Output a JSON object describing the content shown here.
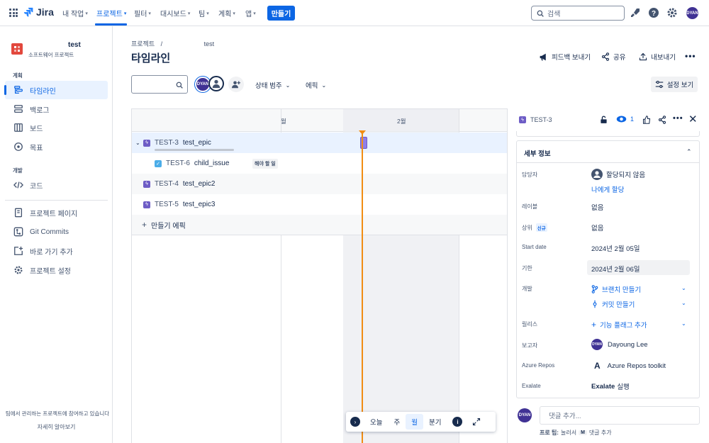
{
  "topnav": {
    "logo": "Jira",
    "items": [
      "내 작업",
      "프로젝트",
      "필터",
      "대시보드",
      "팀",
      "계획",
      "앱"
    ],
    "create": "만들기",
    "search_placeholder": "검색",
    "avatar": "DYAN"
  },
  "sidebar": {
    "project_name": "test",
    "project_type": "소프트웨어 프로젝트",
    "section_plan": "계획",
    "plan_items": [
      "타임라인",
      "백로그",
      "보드",
      "목표"
    ],
    "section_dev": "개발",
    "dev_items": [
      "코드"
    ],
    "other_items": [
      "프로젝트 페이지",
      "Git Commits",
      "바로 가기 추가",
      "프로젝트 설정"
    ],
    "footer_text": "팀에서 관리하는 프로젝트에 참여하고 있습니다",
    "footer_link": "자세히 알아보기"
  },
  "main": {
    "breadcrumb_root": "프로젝트",
    "breadcrumb_sep": "/",
    "breadcrumb_current": "test",
    "title": "타임라인",
    "actions": [
      "피드백 보내기",
      "공유",
      "내보내기"
    ],
    "filter_avatar": "DYAN",
    "filters": [
      "상태 범주",
      "에픽"
    ],
    "view_settings": "설정 보기"
  },
  "timeline": {
    "months": [
      "월",
      "2월"
    ],
    "rows": [
      {
        "key": "TEST-3",
        "summary": "test_epic",
        "type": "epic",
        "expanded": true
      },
      {
        "key": "TEST-6",
        "summary": "child_issue",
        "type": "task",
        "status": "해야 할 일"
      },
      {
        "key": "TEST-4",
        "summary": "test_epic2",
        "type": "epic"
      },
      {
        "key": "TEST-5",
        "summary": "test_epic3",
        "type": "epic"
      }
    ],
    "create_epic": "만들기 에픽",
    "bottom": [
      "오늘",
      "주",
      "월",
      "분기"
    ],
    "active_scale": "월"
  },
  "detail": {
    "issue_key": "TEST-3",
    "watchers": "1",
    "section": "세부 정보",
    "fields": {
      "assignee_label": "담당자",
      "assignee_value": "할당되지 않음",
      "assign_me": "나에게 할당",
      "labels_label": "레이블",
      "labels_value": "없음",
      "parent_label": "상위",
      "parent_badge": "신규",
      "parent_value": "없음",
      "start_label": "Start date",
      "start_value": "2024년 2월 05일",
      "due_label": "기한",
      "due_value": "2024년 2월 06일",
      "dev_label": "개발",
      "dev_branch": "브랜치 만들기",
      "dev_commit": "커밋 만들기",
      "release_label": "릴리스",
      "release_value": "기능 플래그 추가",
      "reporter_label": "보고자",
      "reporter_value": "Dayoung Lee",
      "reporter_avatar": "DYAN",
      "azure_label": "Azure Repos",
      "azure_value": "Azure Repos toolkit",
      "exalate_label": "Exalate",
      "exalate_bold": "Exalate",
      "exalate_rest": "실행"
    },
    "comment_placeholder": "댓글 추가...",
    "comment_avatar": "DYAN",
    "tip_prefix": "프로 팁:",
    "tip_mid": "눌러서",
    "tip_key": "M",
    "tip_suffix": "댓글 추가"
  },
  "colors": {
    "accent": "#0c66e4",
    "epic": "#6e5dc6",
    "today": "#f18d13",
    "project_icon": "#e2483d"
  }
}
